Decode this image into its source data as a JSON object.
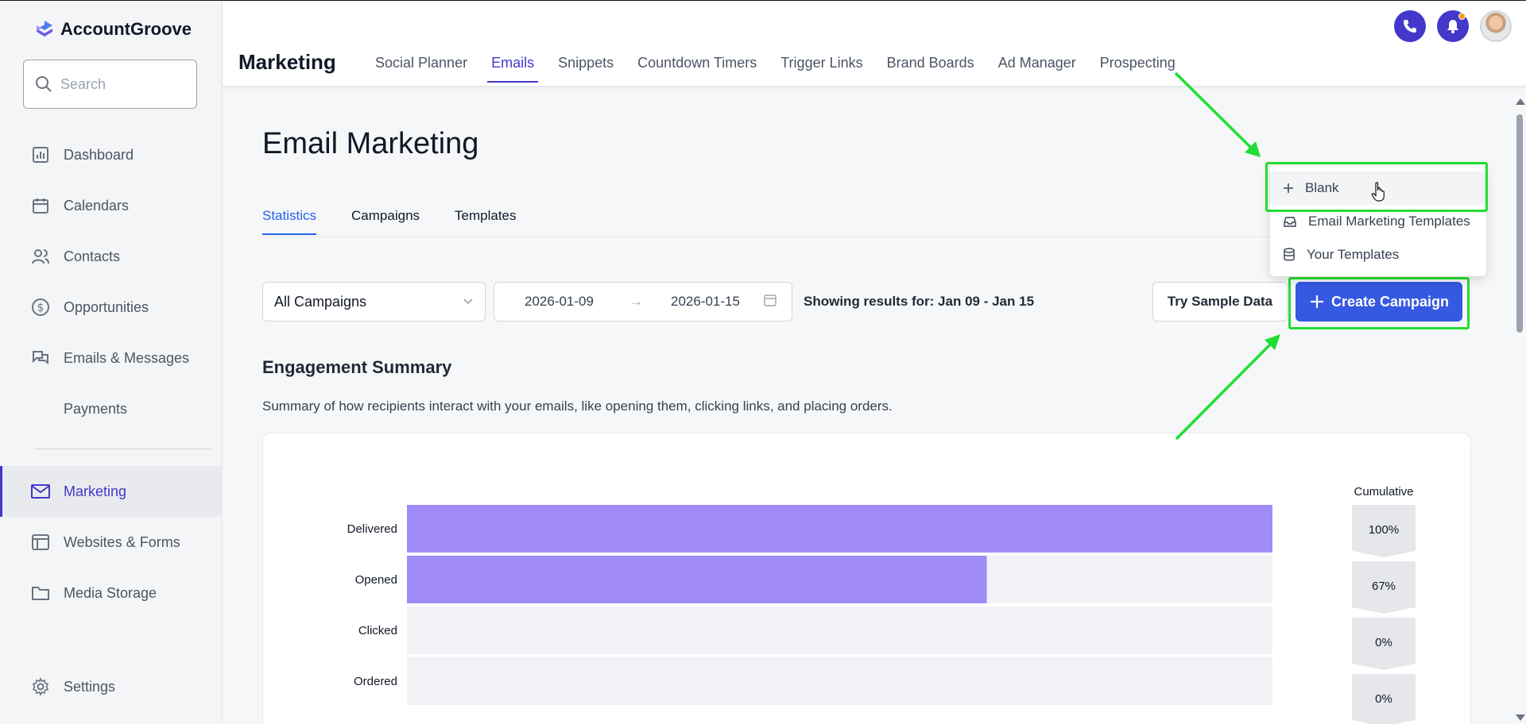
{
  "app": {
    "name": "AccountGroove"
  },
  "sidebar": {
    "search_placeholder": "Search",
    "items": [
      {
        "label": "Dashboard",
        "icon": "chart-icon"
      },
      {
        "label": "Calendars",
        "icon": "calendar-icon"
      },
      {
        "label": "Contacts",
        "icon": "users-icon"
      },
      {
        "label": "Opportunities",
        "icon": "dollar-icon"
      },
      {
        "label": "Emails & Messages",
        "icon": "chat-icon"
      },
      {
        "label": "Payments",
        "icon": ""
      },
      {
        "label": "Marketing",
        "icon": "mail-icon",
        "active": true
      },
      {
        "label": "Websites & Forms",
        "icon": "browser-icon"
      },
      {
        "label": "Media Storage",
        "icon": "folder-icon"
      }
    ],
    "settings_label": "Settings"
  },
  "header": {
    "section_title": "Marketing",
    "tabs": [
      {
        "label": "Social Planner"
      },
      {
        "label": "Emails",
        "active": true
      },
      {
        "label": "Snippets"
      },
      {
        "label": "Countdown Timers"
      },
      {
        "label": "Trigger Links"
      },
      {
        "label": "Brand Boards"
      },
      {
        "label": "Ad Manager"
      },
      {
        "label": "Prospecting"
      }
    ]
  },
  "main": {
    "title": "Email Marketing",
    "sub_tabs": [
      {
        "label": "Statistics",
        "active": true
      },
      {
        "label": "Campaigns"
      },
      {
        "label": "Templates"
      }
    ],
    "filters": {
      "campaign_select": "All Campaigns",
      "date_from": "2026-01-09",
      "date_to": "2026-01-15",
      "results_text": "Showing results for: Jan 09 - Jan 15"
    },
    "try_sample_label": "Try Sample Data",
    "create_campaign_label": "Create Campaign",
    "summary_title": "Engagement Summary",
    "summary_desc": "Summary of how recipients interact with your emails, like opening them, clicking links, and placing orders."
  },
  "dropdown": {
    "items": [
      {
        "label": "Blank",
        "icon": "plus-icon"
      },
      {
        "label": "Email Marketing Templates",
        "icon": "inbox-icon"
      },
      {
        "label": "Your Templates",
        "icon": "database-icon"
      }
    ]
  },
  "chart_data": {
    "type": "bar",
    "orientation": "horizontal",
    "categories": [
      "Delivered",
      "Opened",
      "Clicked",
      "Ordered"
    ],
    "values": [
      100,
      67,
      0,
      0
    ],
    "cumulative_title": "Cumulative",
    "cumulative_labels": [
      "100%",
      "67%",
      "0%",
      "0%"
    ],
    "xlim": [
      0,
      100
    ],
    "colors": {
      "bar": "#a18cf7",
      "track": "#f1f2f5"
    }
  },
  "colors": {
    "accent": "#4338ca",
    "primary_button": "#3559e0",
    "annotation": "#22dd33"
  }
}
